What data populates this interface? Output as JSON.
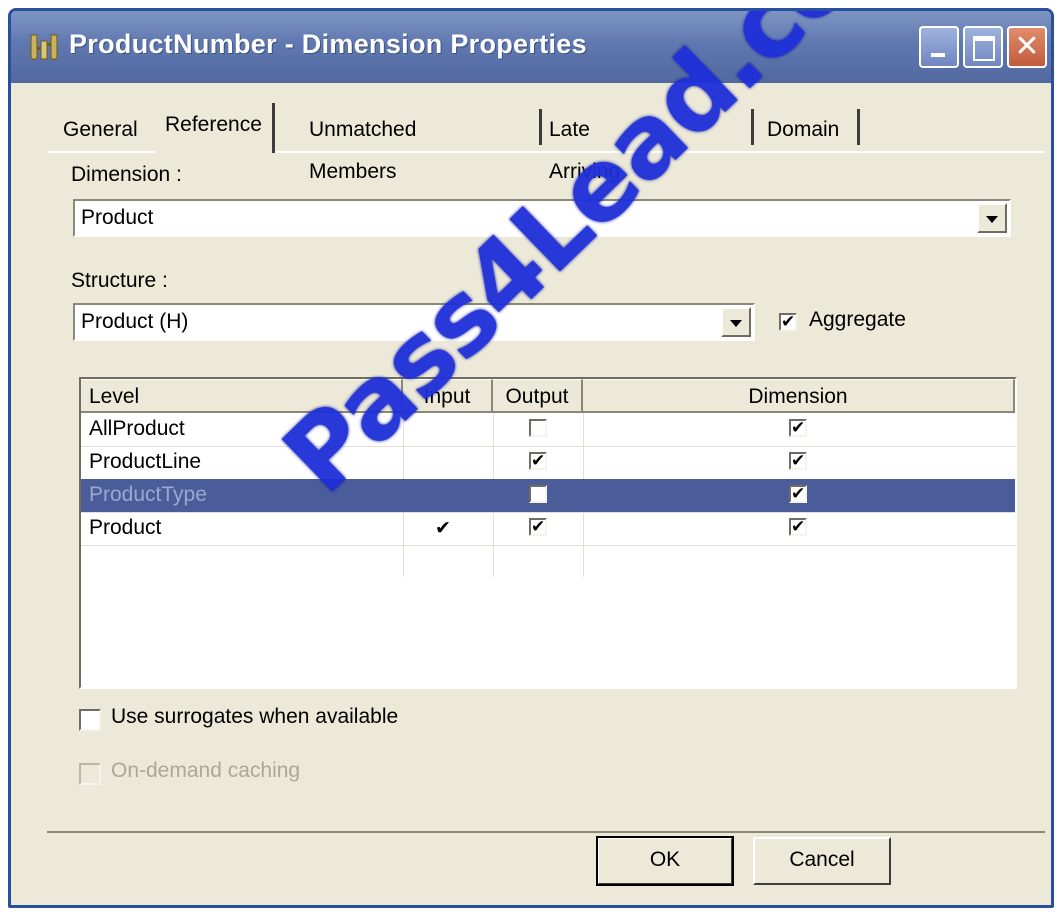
{
  "window": {
    "title": "ProductNumber - Dimension Properties"
  },
  "tabs": [
    {
      "label": "General"
    },
    {
      "label": "Reference",
      "active": true
    },
    {
      "label": "Unmatched Members"
    },
    {
      "label": "Late Arriving Facts"
    },
    {
      "label": "Domain"
    }
  ],
  "dimension": {
    "label": "Dimension :",
    "value": "Product"
  },
  "structure": {
    "label": "Structure :",
    "value": "Product (H)"
  },
  "aggregate": {
    "label": "Aggregate",
    "checked": true
  },
  "grid": {
    "columns": [
      "Level",
      "Input",
      "Output",
      "Dimension"
    ],
    "rows": [
      {
        "level": "AllProduct",
        "input": false,
        "output": false,
        "dimension": true,
        "selected": false
      },
      {
        "level": "ProductLine",
        "input": false,
        "output": true,
        "dimension": true,
        "selected": false
      },
      {
        "level": "ProductType",
        "input": false,
        "output": false,
        "dimension": true,
        "selected": true
      },
      {
        "level": "Product",
        "input": true,
        "output": true,
        "dimension": true,
        "selected": false
      }
    ]
  },
  "options": {
    "surrogates_label": "Use surrogates when available",
    "surrogates_checked": false,
    "caching_label": "On-demand caching",
    "caching_checked": false,
    "caching_enabled": false
  },
  "buttons": {
    "ok": "OK",
    "cancel": "Cancel"
  },
  "watermark": "Pass4Lead.com",
  "colors": {
    "titlebar": "#5f78b0",
    "selection": "#4a5d9a",
    "dialog_bg": "#ece9d8",
    "watermark": "#1e2fd8"
  }
}
